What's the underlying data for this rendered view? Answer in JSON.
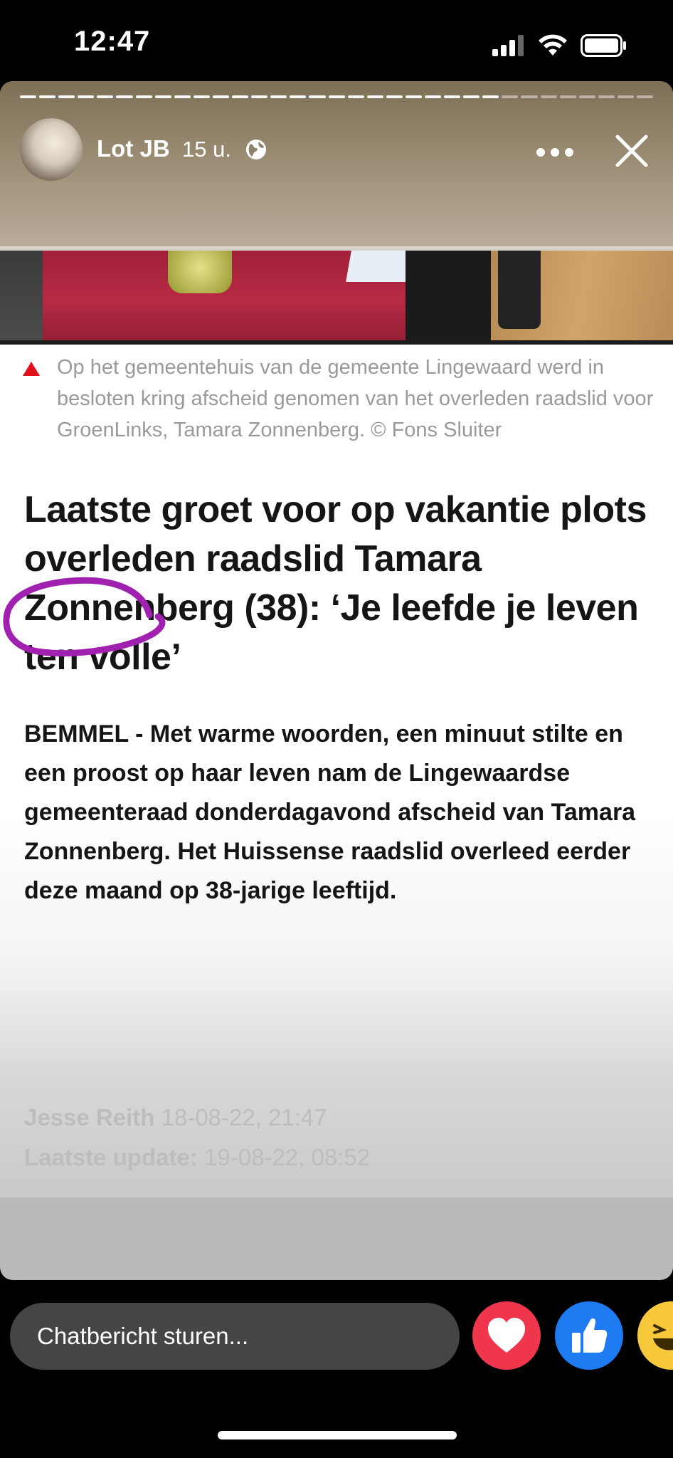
{
  "status_bar": {
    "time": "12:47",
    "icons": [
      "signal-icon",
      "wifi-icon",
      "battery-icon"
    ]
  },
  "story": {
    "author": "Lot JB",
    "time": "15 u.",
    "privacy_icon": "globe-icon",
    "more_icon": "more-icon",
    "close_icon": "close-icon",
    "progress_segments_viewed": 25,
    "progress_segments_total": 33
  },
  "article": {
    "caption": "Op het gemeentehuis van de gemeente Lingewaard werd in besloten kring afscheid genomen van het overleden raadslid voor GroenLinks, Tamara Zonnenberg. © Fons Sluiter",
    "headline": "Laatste groet voor op vakantie plots overleden raadslid Tamara Zonnenberg (38): ‘Je leefde je leven ten volle’",
    "lead": "BEMMEL - Met warme woorden, een minuut stilte en een proost op haar leven nam de Lingewaardse gemeenteraad donderdagavond afscheid van Tamara Zonnenberg. Het Huissense raadslid overleed eerder deze maand op 38-jarige leeftijd.",
    "author": "Jesse Reith",
    "published": "18-08-22, 21:47",
    "update_label": "Laatste update:",
    "updated": "19-08-22, 08:52"
  },
  "bottom": {
    "chat_placeholder": "Chatbericht sturen...",
    "reactions": [
      "heart-icon",
      "like-icon",
      "haha-icon"
    ]
  },
  "colors": {
    "accent_red": "#e0101c",
    "love": "#f0364d",
    "like": "#1f7bf2",
    "haha": "#f7c93a",
    "annotation_purple": "#a020b0"
  }
}
